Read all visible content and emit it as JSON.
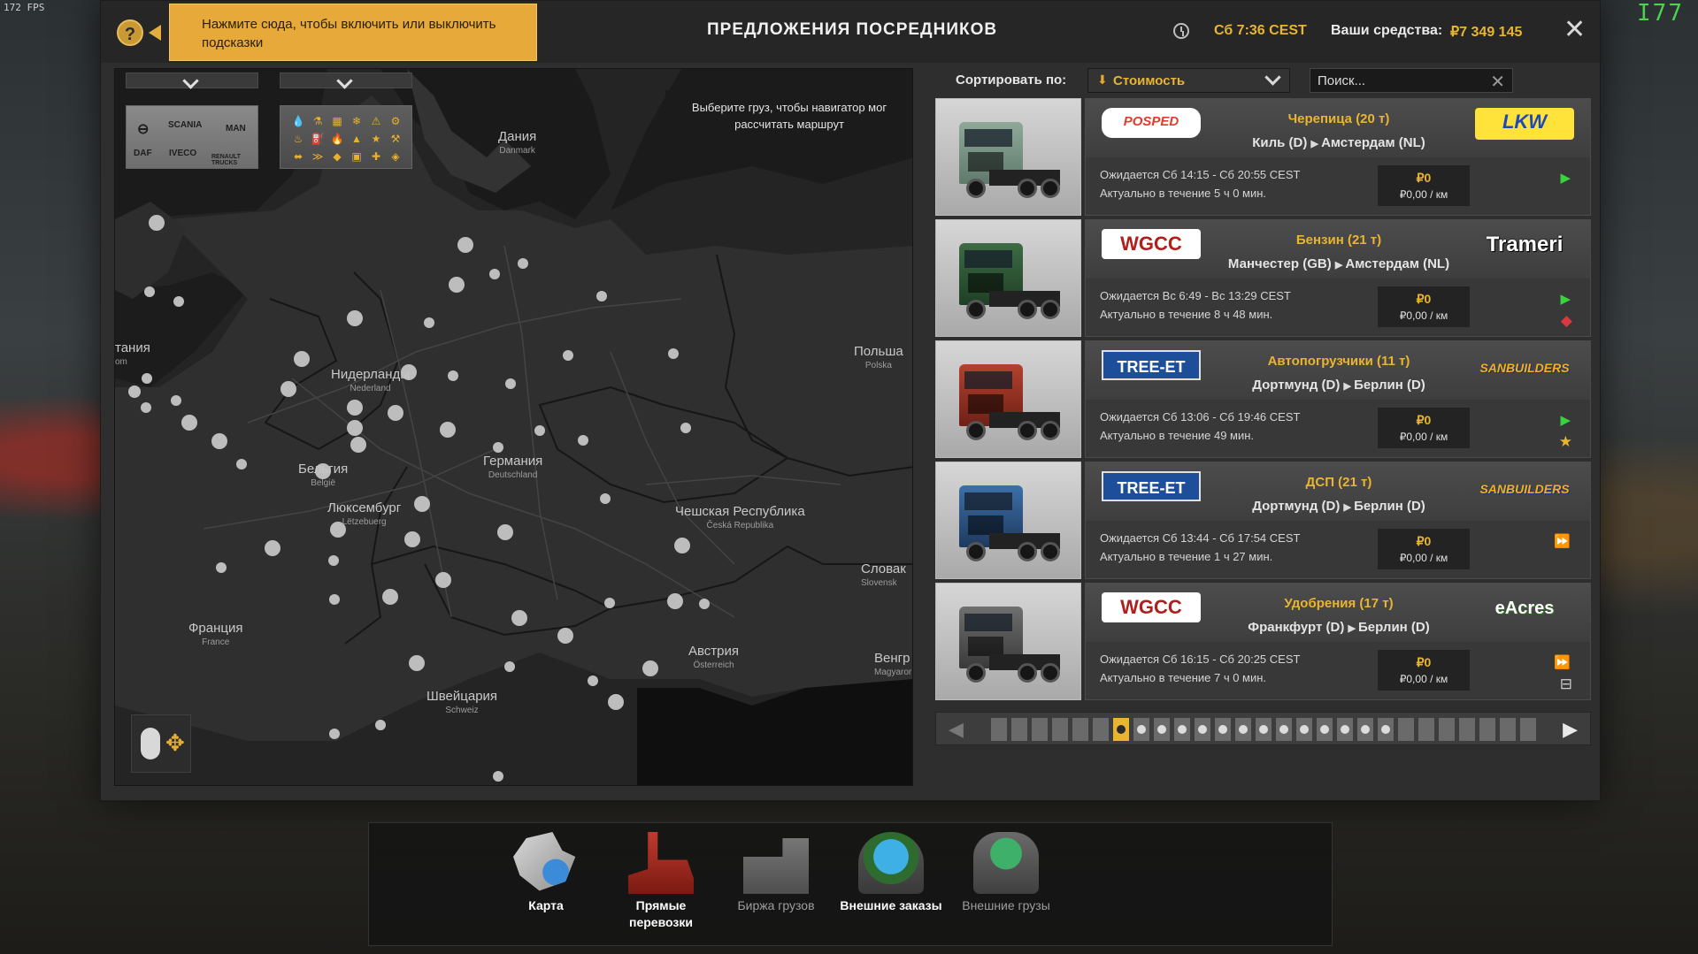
{
  "fps": "172 FPS",
  "corner_glyph": "I77",
  "hint": "Нажмите сюда, чтобы включить или выключить подсказки",
  "title": "ПРЕДЛОЖЕНИЯ ПОСРЕДНИКОВ",
  "clock": "Сб 7:36 CEST",
  "funds_label": "Ваши средства:",
  "funds_value": "₽7 349 145",
  "route_hint": "Выберите груз, чтобы навигатор мог рассчитать маршрут",
  "map": {
    "brands": [
      "SCANIA",
      "DAF",
      "IVECO",
      "MAN",
      "RENAULT TRUCKS"
    ],
    "cargo_icons": [
      "💧",
      "⚗",
      "▦",
      "❄",
      "⚠",
      "⚙",
      "♨",
      "⛽",
      "🔥",
      "▲",
      "★",
      "⚒",
      "⬌",
      "≫",
      "◆",
      "▣",
      "✚",
      "◈"
    ],
    "countries": [
      {
        "name": "Дания",
        "sub": "Danmark"
      },
      {
        "name": "Нидерланды",
        "sub": "Nederland"
      },
      {
        "name": "Бельгия",
        "sub": "België"
      },
      {
        "name": "Люксембург",
        "sub": "Lëtzebuerg"
      },
      {
        "name": "Германия",
        "sub": "Deutschland"
      },
      {
        "name": "Польша",
        "sub": "Polska"
      },
      {
        "name": "Чешская Республика",
        "sub": "Česká Republika"
      },
      {
        "name": "Словак",
        "sub": "Slovensk"
      },
      {
        "name": "Франция",
        "sub": "France"
      },
      {
        "name": "Австрия",
        "sub": "Österreich"
      },
      {
        "name": "Швейцария",
        "sub": "Schweiz"
      },
      {
        "name": "Венгр",
        "sub": "Magyaror"
      },
      {
        "name": "тания",
        "sub": "om"
      }
    ]
  },
  "sort": {
    "label": "Сортировать по:",
    "value": "Стоимость"
  },
  "search": {
    "placeholder": "Поиск..."
  },
  "offers": [
    {
      "logo_left": "POSPED",
      "logo_right": "LKW",
      "cargo": "Черепица (20 т)",
      "from": "Киль (D)",
      "to": "Амстердам (NL)",
      "expect": "Ожидается Сб 14:15 - Сб 20:55 CEST",
      "valid": "Актуально в течение 5 ч 0 мин.",
      "price": "₽0",
      "per_km": "₽0,00 / км",
      "status_icon": "play-green",
      "extra_icon": ""
    },
    {
      "logo_left": "WGCC",
      "logo_right": "Trameri",
      "cargo": "Бензин (21 т)",
      "from": "Манчестер (GB)",
      "to": "Амстердам (NL)",
      "expect": "Ожидается Вс 6:49 - Вс 13:29 CEST",
      "valid": "Актуально в течение 8 ч 48 мин.",
      "price": "₽0",
      "per_km": "₽0,00 / км",
      "status_icon": "play-green",
      "extra_icon": "hazard-red"
    },
    {
      "logo_left": "TREE-ET",
      "logo_right": "SANBUILDERS",
      "cargo": "Автопогрузчики (11 т)",
      "from": "Дортмунд (D)",
      "to": "Берлин (D)",
      "expect": "Ожидается Сб 13:06 - Сб 19:46 CEST",
      "valid": "Актуально в течение 49 мин.",
      "price": "₽0",
      "per_km": "₽0,00 / км",
      "status_icon": "play-green",
      "extra_icon": "star-gold"
    },
    {
      "logo_left": "TREE-ET",
      "logo_right": "SANBUILDERS",
      "cargo": "ДСП (21 т)",
      "from": "Дортмунд (D)",
      "to": "Берлин (D)",
      "expect": "Ожидается Сб 13:44 - Сб 17:54 CEST",
      "valid": "Актуально в течение 1 ч 27 мин.",
      "price": "₽0",
      "per_km": "₽0,00 / км",
      "status_icon": "fast-blue",
      "extra_icon": ""
    },
    {
      "logo_left": "WGCC",
      "logo_right": "eAcres",
      "cargo": "Удобрения (17 т)",
      "from": "Франкфурт (D)",
      "to": "Берлин (D)",
      "expect": "Ожидается Сб 16:15 - Сб 20:25 CEST",
      "valid": "Актуально в течение 7 ч 0 мин.",
      "price": "₽0",
      "per_km": "₽0,00 / км",
      "status_icon": "fast-blue",
      "extra_icon": "trailer-grey"
    }
  ],
  "pager": {
    "current_page": 7,
    "pages": 27
  },
  "dock": [
    {
      "label": "Карта",
      "active": true
    },
    {
      "label": "Прямые перевозки",
      "active": true
    },
    {
      "label": "Биржа грузов",
      "active": false
    },
    {
      "label": "Внешние заказы",
      "active": true
    },
    {
      "label": "Внешние грузы",
      "active": false
    }
  ],
  "colors": {
    "accent": "#e9b531",
    "hint_bg": "#e6a93a",
    "green": "#39d43d",
    "blue": "#3f8fe4"
  }
}
